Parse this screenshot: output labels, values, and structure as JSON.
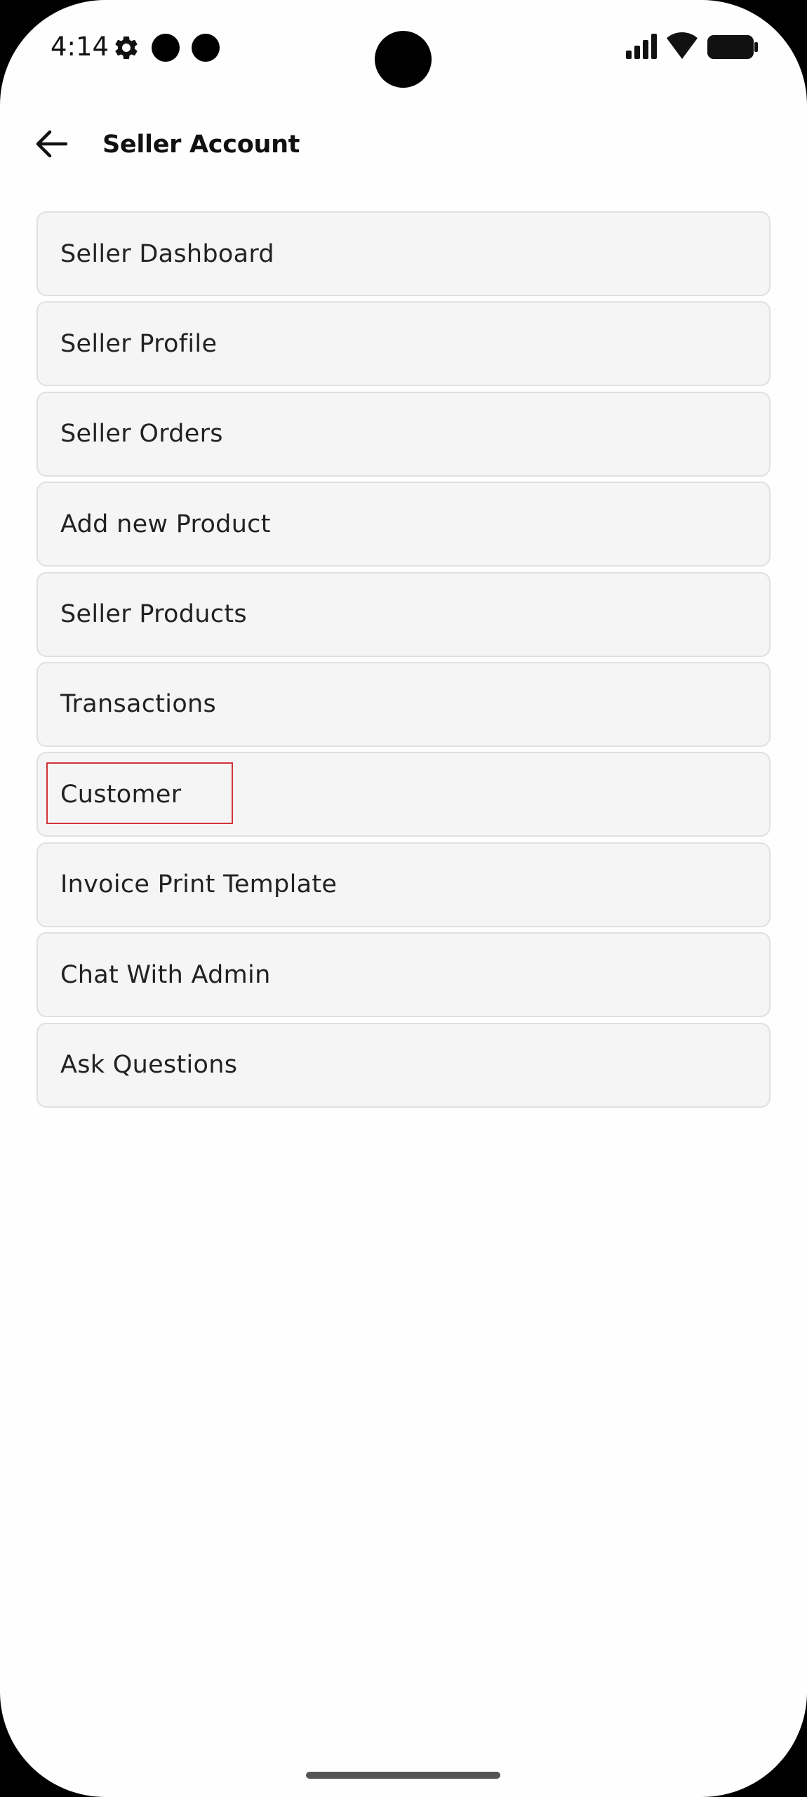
{
  "status_bar": {
    "time": "4:14",
    "icons": [
      "settings-icon",
      "notification-dot-icon",
      "notification-dot-icon",
      "camera-cutout",
      "signal-icon",
      "wifi-icon",
      "battery-icon"
    ]
  },
  "app_bar": {
    "back_icon": "arrow-left-icon",
    "title": "Seller Account"
  },
  "menu": {
    "items": [
      {
        "label": "Seller Dashboard"
      },
      {
        "label": "Seller Profile"
      },
      {
        "label": "Seller Orders"
      },
      {
        "label": "Add new Product"
      },
      {
        "label": "Seller Products"
      },
      {
        "label": "Transactions"
      },
      {
        "label": "Customer",
        "highlighted": true
      },
      {
        "label": "Invoice Print Template"
      },
      {
        "label": "Chat With Admin"
      },
      {
        "label": "Ask Questions"
      }
    ]
  },
  "colors": {
    "background": "#fefefe",
    "item_background": "#f5f5f5",
    "item_border": "#e0e0e0",
    "highlight": "#d0353b"
  }
}
